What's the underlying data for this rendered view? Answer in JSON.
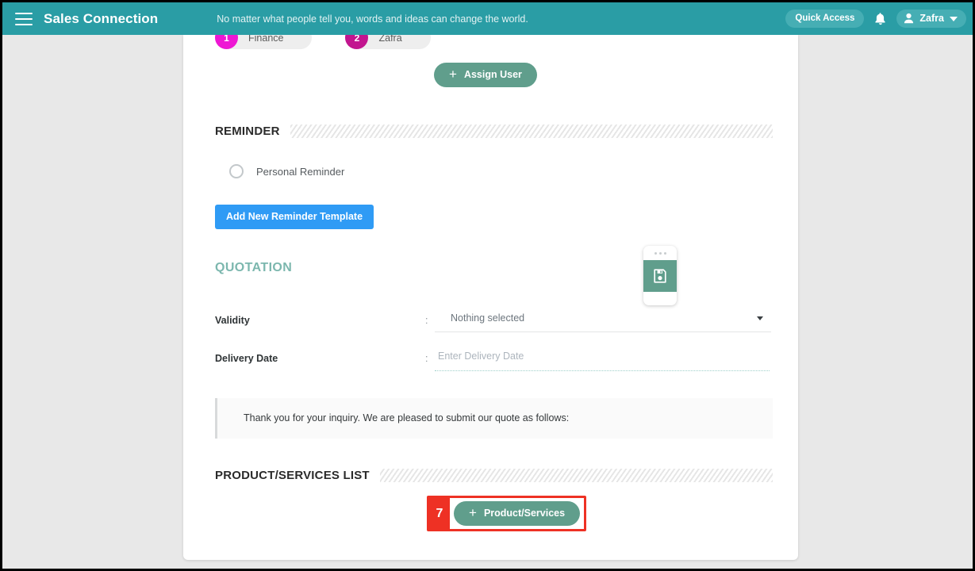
{
  "appbar": {
    "menu_icon": "hamburger-menu-icon",
    "brand": "Sales Connection",
    "tagline": "No matter what people tell you, words and ideas can change the world.",
    "quick_access_label": "Quick Access",
    "bell_icon": "notification-bell-icon",
    "user_icon": "user-avatar-icon",
    "user_name": "Zafra",
    "caret_icon": "chevron-down-icon"
  },
  "assigned_users": {
    "chips": [
      {
        "number": "1",
        "label": "Finance",
        "color": "#ee17d4"
      },
      {
        "number": "2",
        "label": "Zafra",
        "color": "#c2158f"
      }
    ],
    "assign_button_label": "Assign User",
    "assign_button_icon": "plus-icon"
  },
  "reminder": {
    "heading": "REMINDER",
    "radio_label": "Personal Reminder",
    "radio_icon": "radio-unchecked-icon",
    "add_template_label": "Add New Reminder Template"
  },
  "quotation": {
    "title": "QUOTATION",
    "validity": {
      "label": "Validity",
      "colon": ":",
      "value": "Nothing selected",
      "caret_icon": "dropdown-caret-icon"
    },
    "delivery_date": {
      "label": "Delivery Date",
      "colon": ":",
      "placeholder": "Enter Delivery Date",
      "value": ""
    },
    "note": "Thank you for your inquiry. We are pleased to submit our quote as follows:"
  },
  "products": {
    "heading": "PRODUCT/SERVICES LIST",
    "add_button_label": "Product/Services",
    "add_button_icon": "plus-icon",
    "step_number": "7",
    "highlight_color": "#ee3124"
  },
  "save_widget": {
    "icon": "floppy-save-icon",
    "band_color": "#609e8c"
  },
  "theme": {
    "appbar": "#2a9da5",
    "teal_button": "#609e8c",
    "blue_button": "#2f9bf5",
    "quotation_heading": "#7cb7ae",
    "page_background": "#e8e8e8"
  }
}
